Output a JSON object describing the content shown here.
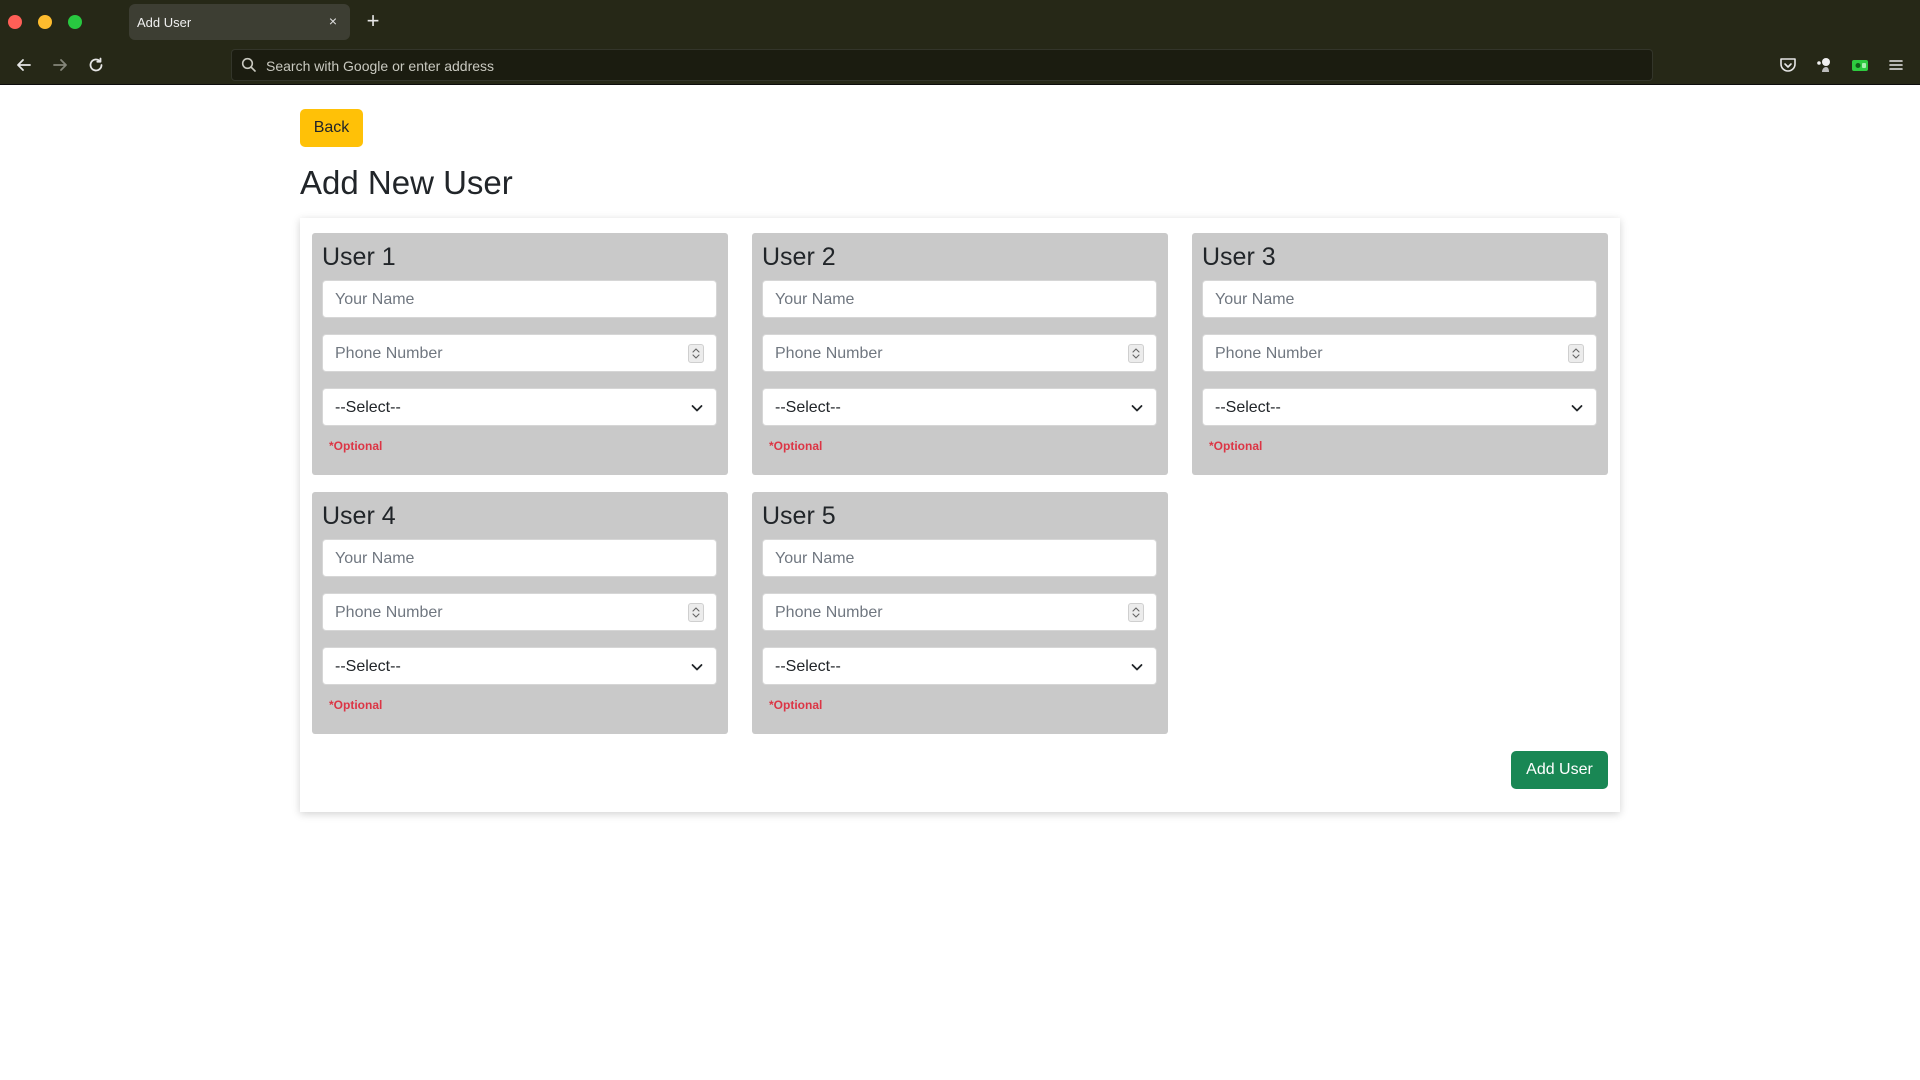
{
  "browser": {
    "tab_title": "Add User",
    "tab_close": "×",
    "new_tab": "+",
    "address_placeholder": "Search with Google or enter address"
  },
  "page": {
    "back_label": "Back",
    "title": "Add New User",
    "submit_label": "Add User"
  },
  "users": [
    {
      "title": "User 1",
      "name_placeholder": "Your Name",
      "phone_placeholder": "Phone Number",
      "select_value": "--Select--",
      "optional": "*Optional"
    },
    {
      "title": "User 2",
      "name_placeholder": "Your Name",
      "phone_placeholder": "Phone Number",
      "select_value": "--Select--",
      "optional": "*Optional"
    },
    {
      "title": "User 3",
      "name_placeholder": "Your Name",
      "phone_placeholder": "Phone Number",
      "select_value": "--Select--",
      "optional": "*Optional"
    },
    {
      "title": "User 4",
      "name_placeholder": "Your Name",
      "phone_placeholder": "Phone Number",
      "select_value": "--Select--",
      "optional": "*Optional"
    },
    {
      "title": "User 5",
      "name_placeholder": "Your Name",
      "phone_placeholder": "Phone Number",
      "select_value": "--Select--",
      "optional": "*Optional"
    }
  ],
  "colors": {
    "back_button": "#ffc107",
    "add_button": "#198754",
    "optional_text": "#dc3545",
    "user_block": "#c9c9c9"
  },
  "icons": {
    "search": "search-icon",
    "back": "arrow-left-icon",
    "forward": "arrow-right-icon",
    "reload": "reload-icon",
    "pocket": "pocket-icon",
    "extension": "extension-icon",
    "account": "account-icon",
    "menu": "hamburger-menu-icon"
  }
}
